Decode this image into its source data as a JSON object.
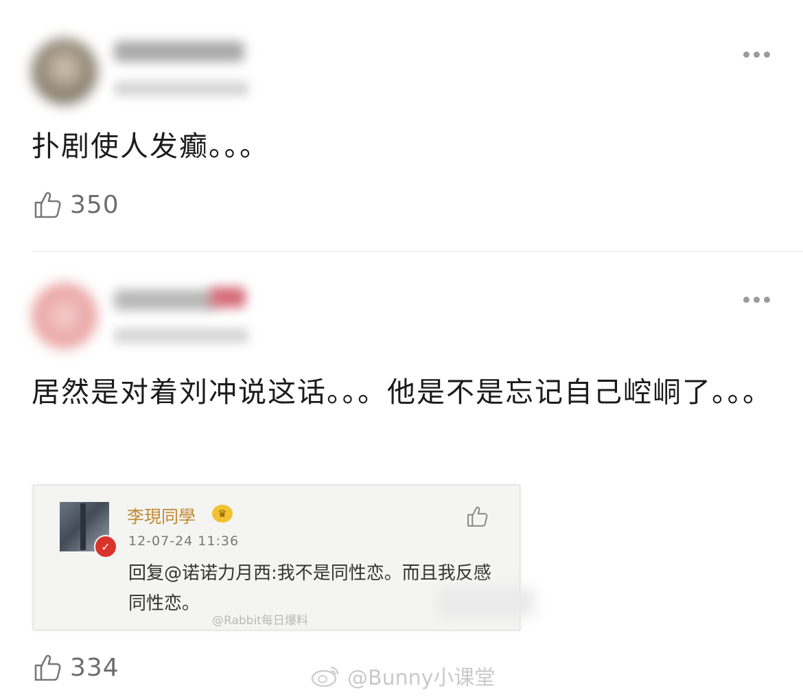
{
  "comments": [
    {
      "text": "扑剧使人发癫。。。",
      "likes": "350"
    },
    {
      "text": "居然是对着刘冲说这话。。。他是不是忘记自己崆峒了。。。",
      "likes": "334",
      "embed": {
        "name": "李現同學",
        "time": "12-07-24 11:36",
        "text": "回复@诺诺力月西:我不是同性恋。而且我反感同性恋。",
        "watermark": "@Rabbit每日爆料"
      }
    }
  ],
  "watermark": "@Bunny小课堂",
  "icons": [
    "more-icon",
    "thumbs-up-icon",
    "crown-icon",
    "vip-icon",
    "weibo-icon"
  ],
  "colors": {
    "text": "#1b1b1b",
    "muted": "#6d6d6d",
    "embed_name": "#c08a2e"
  }
}
